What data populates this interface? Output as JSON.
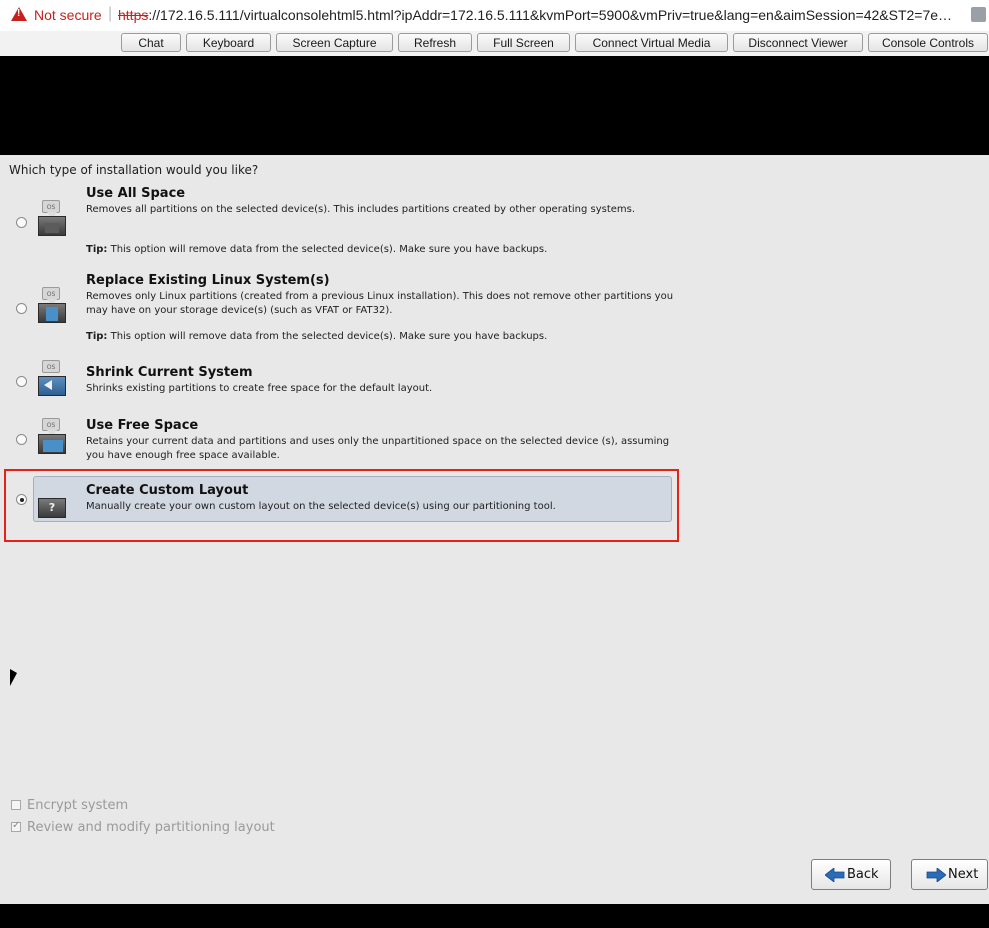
{
  "browser": {
    "security_warning": "Not secure",
    "url_scheme": "https",
    "url_rest": "://172.16.5.111/virtualconsolehtml5.html?ipAddr=172.16.5.111&kvmPort=5900&vmPriv=true&lang=en&aimSession=42&ST2=7e…"
  },
  "toolbar": {
    "buttons": [
      "Chat",
      "Keyboard",
      "Screen Capture",
      "Refresh",
      "Full Screen",
      "Connect Virtual Media",
      "Disconnect Viewer",
      "Console Controls"
    ]
  },
  "installer": {
    "question": "Which type of installation would you like?",
    "icon_badge": "OS",
    "options": [
      {
        "title": "Use All Space",
        "desc": "Removes all partitions on the selected device(s).  This includes partitions created by other operating systems.",
        "tip_label": "Tip:",
        "tip": " This option will remove data from the selected device(s).  Make sure you have backups.",
        "selected": false
      },
      {
        "title": "Replace Existing Linux System(s)",
        "desc": "Removes only Linux partitions (created from a previous Linux installation).  This does not remove other partitions you may have on your storage device(s) (such as VFAT or FAT32).",
        "tip_label": "Tip:",
        "tip": " This option will remove data from the selected device(s).  Make sure you have backups.",
        "selected": false
      },
      {
        "title": "Shrink Current System",
        "desc": "Shrinks existing partitions to create free space for the default layout.",
        "selected": false
      },
      {
        "title": "Use Free Space",
        "desc": "Retains your current data and partitions and uses only the unpartitioned space on the selected device (s), assuming you have enough free space available.",
        "selected": false
      },
      {
        "title": "Create Custom Layout",
        "desc": "Manually create your own custom layout on the selected device(s) using our partitioning tool.",
        "icon_symbol": "?",
        "selected": true
      }
    ],
    "encrypt_label": "Encrypt system",
    "encrypt_checked": false,
    "review_label": "Review and modify partitioning layout",
    "review_checked": true,
    "back_label": "Back",
    "next_label": "Next"
  },
  "colors": {
    "highlight_border": "#e8201a",
    "arrow_blue": "#2b6cb8",
    "not_secure": "#c5221f"
  }
}
